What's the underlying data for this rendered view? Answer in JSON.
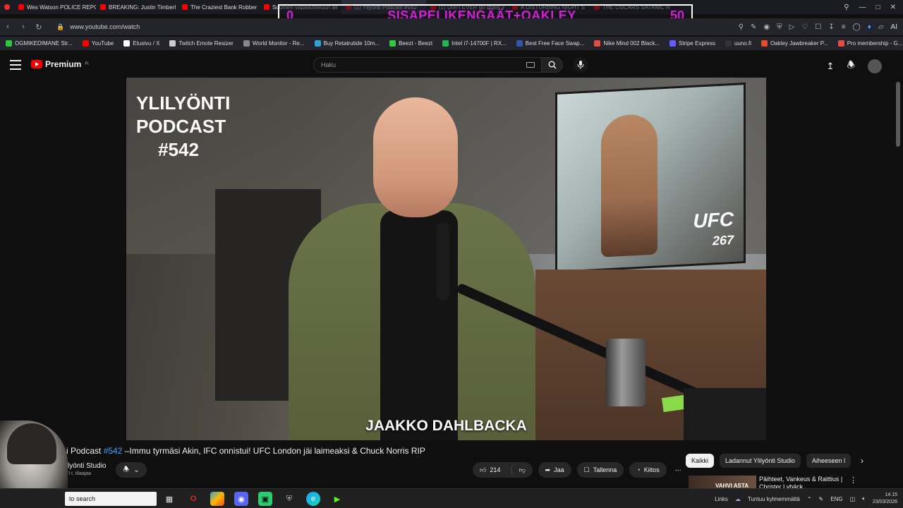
{
  "browser": {
    "tabs": [
      {
        "label": "Wes Watson POLICE REPO",
        "color": "#ff0000"
      },
      {
        "label": "BREAKING: Justin Timberl",
        "color": "#ff0000"
      },
      {
        "label": "The Craziest Bank Robber",
        "color": "#ff0000"
      },
      {
        "label": "Suomen vapaaotteluun all",
        "color": "#ff0000"
      },
      {
        "label": "(1) Yllyönti Podcast #542",
        "color": "#ff0000",
        "active": true
      },
      {
        "label": "(1) Don't EVER go down y",
        "color": "#ff0000"
      },
      {
        "label": "A DISTURBING NIGHT S",
        "color": "#ff0000"
      },
      {
        "label": "THE OSCARS SATANIC R",
        "color": "#ff0000"
      }
    ],
    "url": "www.youtube.com/watch",
    "bookmarks": [
      {
        "label": "OGMIKEDIMANE Str...",
        "color": "#27c93f"
      },
      {
        "label": "YouTube",
        "color": "#ff0000"
      },
      {
        "label": "Etusivu / X",
        "color": "#ffffff"
      },
      {
        "label": "Twitch Emote Resizer",
        "color": "#cccccc"
      },
      {
        "label": "World Monitor - Re...",
        "color": "#888888"
      },
      {
        "label": "Buy Retatrutide 10m...",
        "color": "#2aa3d8"
      },
      {
        "label": "Beezt - Beezt",
        "color": "#2ecc40"
      },
      {
        "label": "Intel i7-14700F | RX...",
        "color": "#1db954"
      },
      {
        "label": "Best Free Face Swap...",
        "color": "#3355aa"
      },
      {
        "label": "Nike Mind 002 Black...",
        "color": "#e74c3c"
      },
      {
        "label": "Stripe Express",
        "color": "#635bff"
      },
      {
        "label": "uuno.fi",
        "color": "#333333"
      },
      {
        "label": "Oakley Jawbreaker P...",
        "color": "#e84a2b"
      },
      {
        "label": "Pro membership - G...",
        "color": "#e74c3c"
      }
    ]
  },
  "overlay": {
    "left_score": "0",
    "title": "SISAPELIKENGÄÄT+OAKLEY",
    "right_score": "50",
    "color": "#d21fd6"
  },
  "youtube": {
    "brand": "Premium",
    "brand_sup": "FI",
    "search_placeholder": "Haku"
  },
  "video": {
    "show_title_lines": [
      "YLILYÖNTI",
      "PODCAST",
      "#542"
    ],
    "caption": "JAAKKO DAHLBACKA",
    "tv_text": [
      "UFC",
      "267"
    ]
  },
  "meta": {
    "title_prefix": "i Podcast ",
    "title_tag": "#542",
    "title_rest": " –Immu tyrmäsi Akin, IFC onnistui! UFC London jäi laimeaksi & Chuck Norris RIP",
    "channel": "lyönti Studio",
    "subs": "’i t. tilaajaa",
    "likes": "214",
    "share_label": "Jaa",
    "save_label": "Tallenna",
    "thanks_label": "Kiitos",
    "more_label": "⋯"
  },
  "chips": [
    "Kaikki",
    "Ladannut Ylilyönti Studio",
    "Aiheeseen l"
  ],
  "recommended": {
    "thumb_text": "VAHVI ASTA",
    "title_line1": "Päihteet, Vankeus & Raittius |",
    "title_line2": "Christer Lybäck"
  },
  "taskbar": {
    "search_text": "to search",
    "links": "Links",
    "weather": "Tuntuu kylmemmältä",
    "lang": "ENG",
    "time": "14.15",
    "date": "23/03/2026"
  }
}
